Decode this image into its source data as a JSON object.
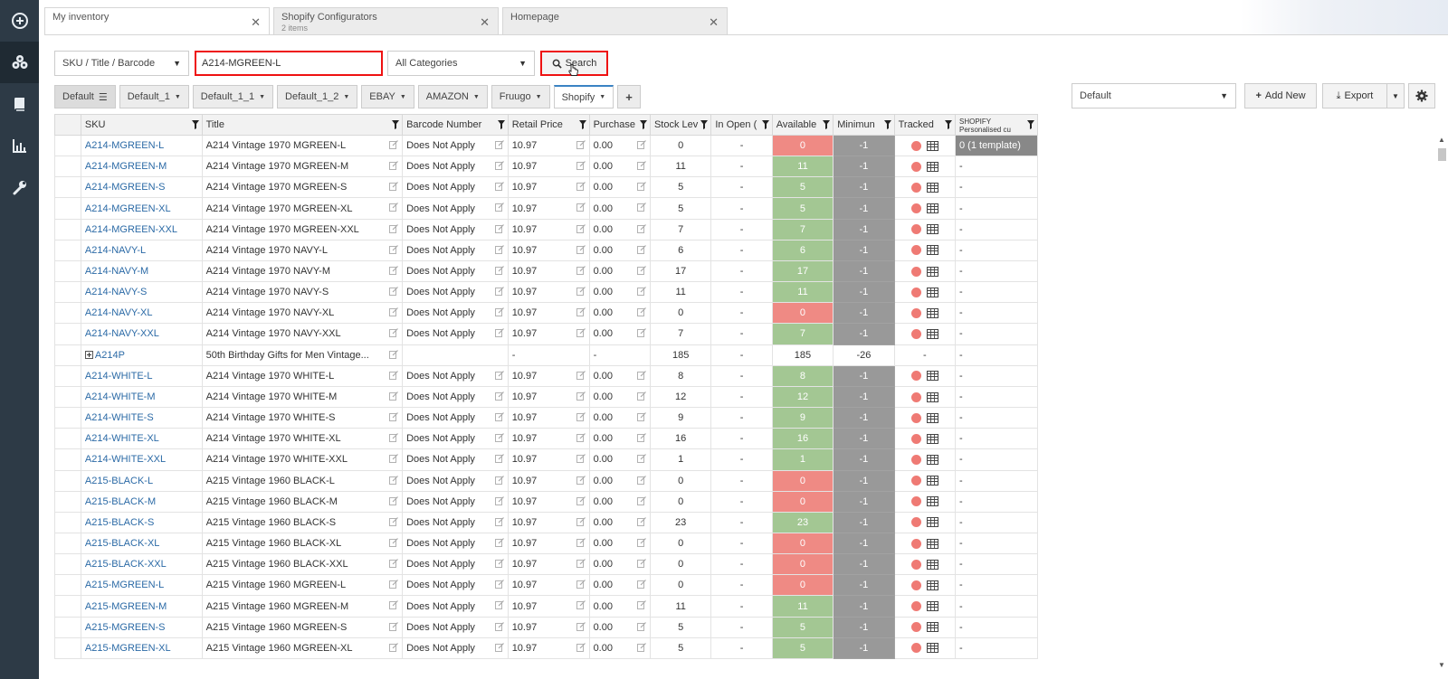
{
  "tabs": [
    {
      "title": "My inventory",
      "subtitle": ""
    },
    {
      "title": "Shopify Configurators",
      "subtitle": "2 items"
    },
    {
      "title": "Homepage",
      "subtitle": ""
    }
  ],
  "search": {
    "field_select": "SKU / Title / Barcode",
    "query": "A214-MGREEN-L",
    "category_select": "All Categories",
    "button_label": "Search"
  },
  "view_tabs": [
    "Default",
    "Default_1",
    "Default_1_1",
    "Default_1_2",
    "EBAY",
    "AMAZON",
    "Fruugo",
    "Shopify"
  ],
  "right_controls": {
    "view_select": "Default",
    "add_new": "Add New",
    "export": "Export"
  },
  "columns": [
    "SKU",
    "Title",
    "Barcode Number",
    "Retail Price",
    "Purchase",
    "Stock Lev",
    "In Open (",
    "Available",
    "Minimun",
    "Tracked",
    "SHOPIFY"
  ],
  "shopify_sub": "Personalised cu",
  "rows": [
    {
      "sku": "A214-MGREEN-L",
      "title": "A214 Vintage 1970 MGREEN-L",
      "barcode": "Does Not Apply",
      "price": "10.97",
      "purchase": "0.00",
      "stock": "0",
      "open": "-",
      "avail": "0",
      "st": "red",
      "min": "-1",
      "tracked": true,
      "shop": "0 (1 template)"
    },
    {
      "sku": "A214-MGREEN-M",
      "title": "A214 Vintage 1970 MGREEN-M",
      "barcode": "Does Not Apply",
      "price": "10.97",
      "purchase": "0.00",
      "stock": "11",
      "open": "-",
      "avail": "11",
      "st": "green",
      "min": "-1",
      "tracked": true,
      "shop": "-"
    },
    {
      "sku": "A214-MGREEN-S",
      "title": "A214 Vintage 1970 MGREEN-S",
      "barcode": "Does Not Apply",
      "price": "10.97",
      "purchase": "0.00",
      "stock": "5",
      "open": "-",
      "avail": "5",
      "st": "green",
      "min": "-1",
      "tracked": true,
      "shop": "-"
    },
    {
      "sku": "A214-MGREEN-XL",
      "title": "A214 Vintage 1970 MGREEN-XL",
      "barcode": "Does Not Apply",
      "price": "10.97",
      "purchase": "0.00",
      "stock": "5",
      "open": "-",
      "avail": "5",
      "st": "green",
      "min": "-1",
      "tracked": true,
      "shop": "-"
    },
    {
      "sku": "A214-MGREEN-XXL",
      "title": "A214 Vintage 1970 MGREEN-XXL",
      "barcode": "Does Not Apply",
      "price": "10.97",
      "purchase": "0.00",
      "stock": "7",
      "open": "-",
      "avail": "7",
      "st": "green",
      "min": "-1",
      "tracked": true,
      "shop": "-"
    },
    {
      "sku": "A214-NAVY-L",
      "title": "A214 Vintage 1970 NAVY-L",
      "barcode": "Does Not Apply",
      "price": "10.97",
      "purchase": "0.00",
      "stock": "6",
      "open": "-",
      "avail": "6",
      "st": "green",
      "min": "-1",
      "tracked": true,
      "shop": "-"
    },
    {
      "sku": "A214-NAVY-M",
      "title": "A214 Vintage 1970 NAVY-M",
      "barcode": "Does Not Apply",
      "price": "10.97",
      "purchase": "0.00",
      "stock": "17",
      "open": "-",
      "avail": "17",
      "st": "green",
      "min": "-1",
      "tracked": true,
      "shop": "-"
    },
    {
      "sku": "A214-NAVY-S",
      "title": "A214 Vintage 1970 NAVY-S",
      "barcode": "Does Not Apply",
      "price": "10.97",
      "purchase": "0.00",
      "stock": "11",
      "open": "-",
      "avail": "11",
      "st": "green",
      "min": "-1",
      "tracked": true,
      "shop": "-"
    },
    {
      "sku": "A214-NAVY-XL",
      "title": "A214 Vintage 1970 NAVY-XL",
      "barcode": "Does Not Apply",
      "price": "10.97",
      "purchase": "0.00",
      "stock": "0",
      "open": "-",
      "avail": "0",
      "st": "red",
      "min": "-1",
      "tracked": true,
      "shop": "-"
    },
    {
      "sku": "A214-NAVY-XXL",
      "title": "A214 Vintage 1970 NAVY-XXL",
      "barcode": "Does Not Apply",
      "price": "10.97",
      "purchase": "0.00",
      "stock": "7",
      "open": "-",
      "avail": "7",
      "st": "green",
      "min": "-1",
      "tracked": true,
      "shop": "-"
    },
    {
      "sku": "A214P",
      "title": "50th Birthday Gifts for Men Vintage...",
      "barcode": "",
      "price": "-",
      "purchase": "-",
      "stock": "185",
      "open": "-",
      "avail": "185",
      "st": "white",
      "min": "-26",
      "tracked": false,
      "shop": "-",
      "parent": true
    },
    {
      "sku": "A214-WHITE-L",
      "title": "A214 Vintage 1970 WHITE-L",
      "barcode": "Does Not Apply",
      "price": "10.97",
      "purchase": "0.00",
      "stock": "8",
      "open": "-",
      "avail": "8",
      "st": "green",
      "min": "-1",
      "tracked": true,
      "shop": "-"
    },
    {
      "sku": "A214-WHITE-M",
      "title": "A214 Vintage 1970 WHITE-M",
      "barcode": "Does Not Apply",
      "price": "10.97",
      "purchase": "0.00",
      "stock": "12",
      "open": "-",
      "avail": "12",
      "st": "green",
      "min": "-1",
      "tracked": true,
      "shop": "-"
    },
    {
      "sku": "A214-WHITE-S",
      "title": "A214 Vintage 1970 WHITE-S",
      "barcode": "Does Not Apply",
      "price": "10.97",
      "purchase": "0.00",
      "stock": "9",
      "open": "-",
      "avail": "9",
      "st": "green",
      "min": "-1",
      "tracked": true,
      "shop": "-"
    },
    {
      "sku": "A214-WHITE-XL",
      "title": "A214 Vintage 1970 WHITE-XL",
      "barcode": "Does Not Apply",
      "price": "10.97",
      "purchase": "0.00",
      "stock": "16",
      "open": "-",
      "avail": "16",
      "st": "green",
      "min": "-1",
      "tracked": true,
      "shop": "-"
    },
    {
      "sku": "A214-WHITE-XXL",
      "title": "A214 Vintage 1970 WHITE-XXL",
      "barcode": "Does Not Apply",
      "price": "10.97",
      "purchase": "0.00",
      "stock": "1",
      "open": "-",
      "avail": "1",
      "st": "green",
      "min": "-1",
      "tracked": true,
      "shop": "-"
    },
    {
      "sku": "A215-BLACK-L",
      "title": "A215 Vintage 1960 BLACK-L",
      "barcode": "Does Not Apply",
      "price": "10.97",
      "purchase": "0.00",
      "stock": "0",
      "open": "-",
      "avail": "0",
      "st": "red",
      "min": "-1",
      "tracked": true,
      "shop": "-"
    },
    {
      "sku": "A215-BLACK-M",
      "title": "A215 Vintage 1960 BLACK-M",
      "barcode": "Does Not Apply",
      "price": "10.97",
      "purchase": "0.00",
      "stock": "0",
      "open": "-",
      "avail": "0",
      "st": "red",
      "min": "-1",
      "tracked": true,
      "shop": "-"
    },
    {
      "sku": "A215-BLACK-S",
      "title": "A215 Vintage 1960 BLACK-S",
      "barcode": "Does Not Apply",
      "price": "10.97",
      "purchase": "0.00",
      "stock": "23",
      "open": "-",
      "avail": "23",
      "st": "green",
      "min": "-1",
      "tracked": true,
      "shop": "-"
    },
    {
      "sku": "A215-BLACK-XL",
      "title": "A215 Vintage 1960 BLACK-XL",
      "barcode": "Does Not Apply",
      "price": "10.97",
      "purchase": "0.00",
      "stock": "0",
      "open": "-",
      "avail": "0",
      "st": "red",
      "min": "-1",
      "tracked": true,
      "shop": "-"
    },
    {
      "sku": "A215-BLACK-XXL",
      "title": "A215 Vintage 1960 BLACK-XXL",
      "barcode": "Does Not Apply",
      "price": "10.97",
      "purchase": "0.00",
      "stock": "0",
      "open": "-",
      "avail": "0",
      "st": "red",
      "min": "-1",
      "tracked": true,
      "shop": "-"
    },
    {
      "sku": "A215-MGREEN-L",
      "title": "A215 Vintage 1960 MGREEN-L",
      "barcode": "Does Not Apply",
      "price": "10.97",
      "purchase": "0.00",
      "stock": "0",
      "open": "-",
      "avail": "0",
      "st": "red",
      "min": "-1",
      "tracked": true,
      "shop": "-"
    },
    {
      "sku": "A215-MGREEN-M",
      "title": "A215 Vintage 1960 MGREEN-M",
      "barcode": "Does Not Apply",
      "price": "10.97",
      "purchase": "0.00",
      "stock": "11",
      "open": "-",
      "avail": "11",
      "st": "green",
      "min": "-1",
      "tracked": true,
      "shop": "-"
    },
    {
      "sku": "A215-MGREEN-S",
      "title": "A215 Vintage 1960 MGREEN-S",
      "barcode": "Does Not Apply",
      "price": "10.97",
      "purchase": "0.00",
      "stock": "5",
      "open": "-",
      "avail": "5",
      "st": "green",
      "min": "-1",
      "tracked": true,
      "shop": "-"
    },
    {
      "sku": "A215-MGREEN-XL",
      "title": "A215 Vintage 1960 MGREEN-XL",
      "barcode": "Does Not Apply",
      "price": "10.97",
      "purchase": "0.00",
      "stock": "5",
      "open": "-",
      "avail": "5",
      "st": "green",
      "min": "-1",
      "tracked": true,
      "shop": "-"
    }
  ],
  "colors": {
    "available_green": "#a3c793",
    "available_red": "#ef8a84",
    "minimum_grey": "#999999",
    "link_blue": "#2b6aa6",
    "sidebar": "#2d3a46",
    "highlight_red": "#ee1111"
  }
}
